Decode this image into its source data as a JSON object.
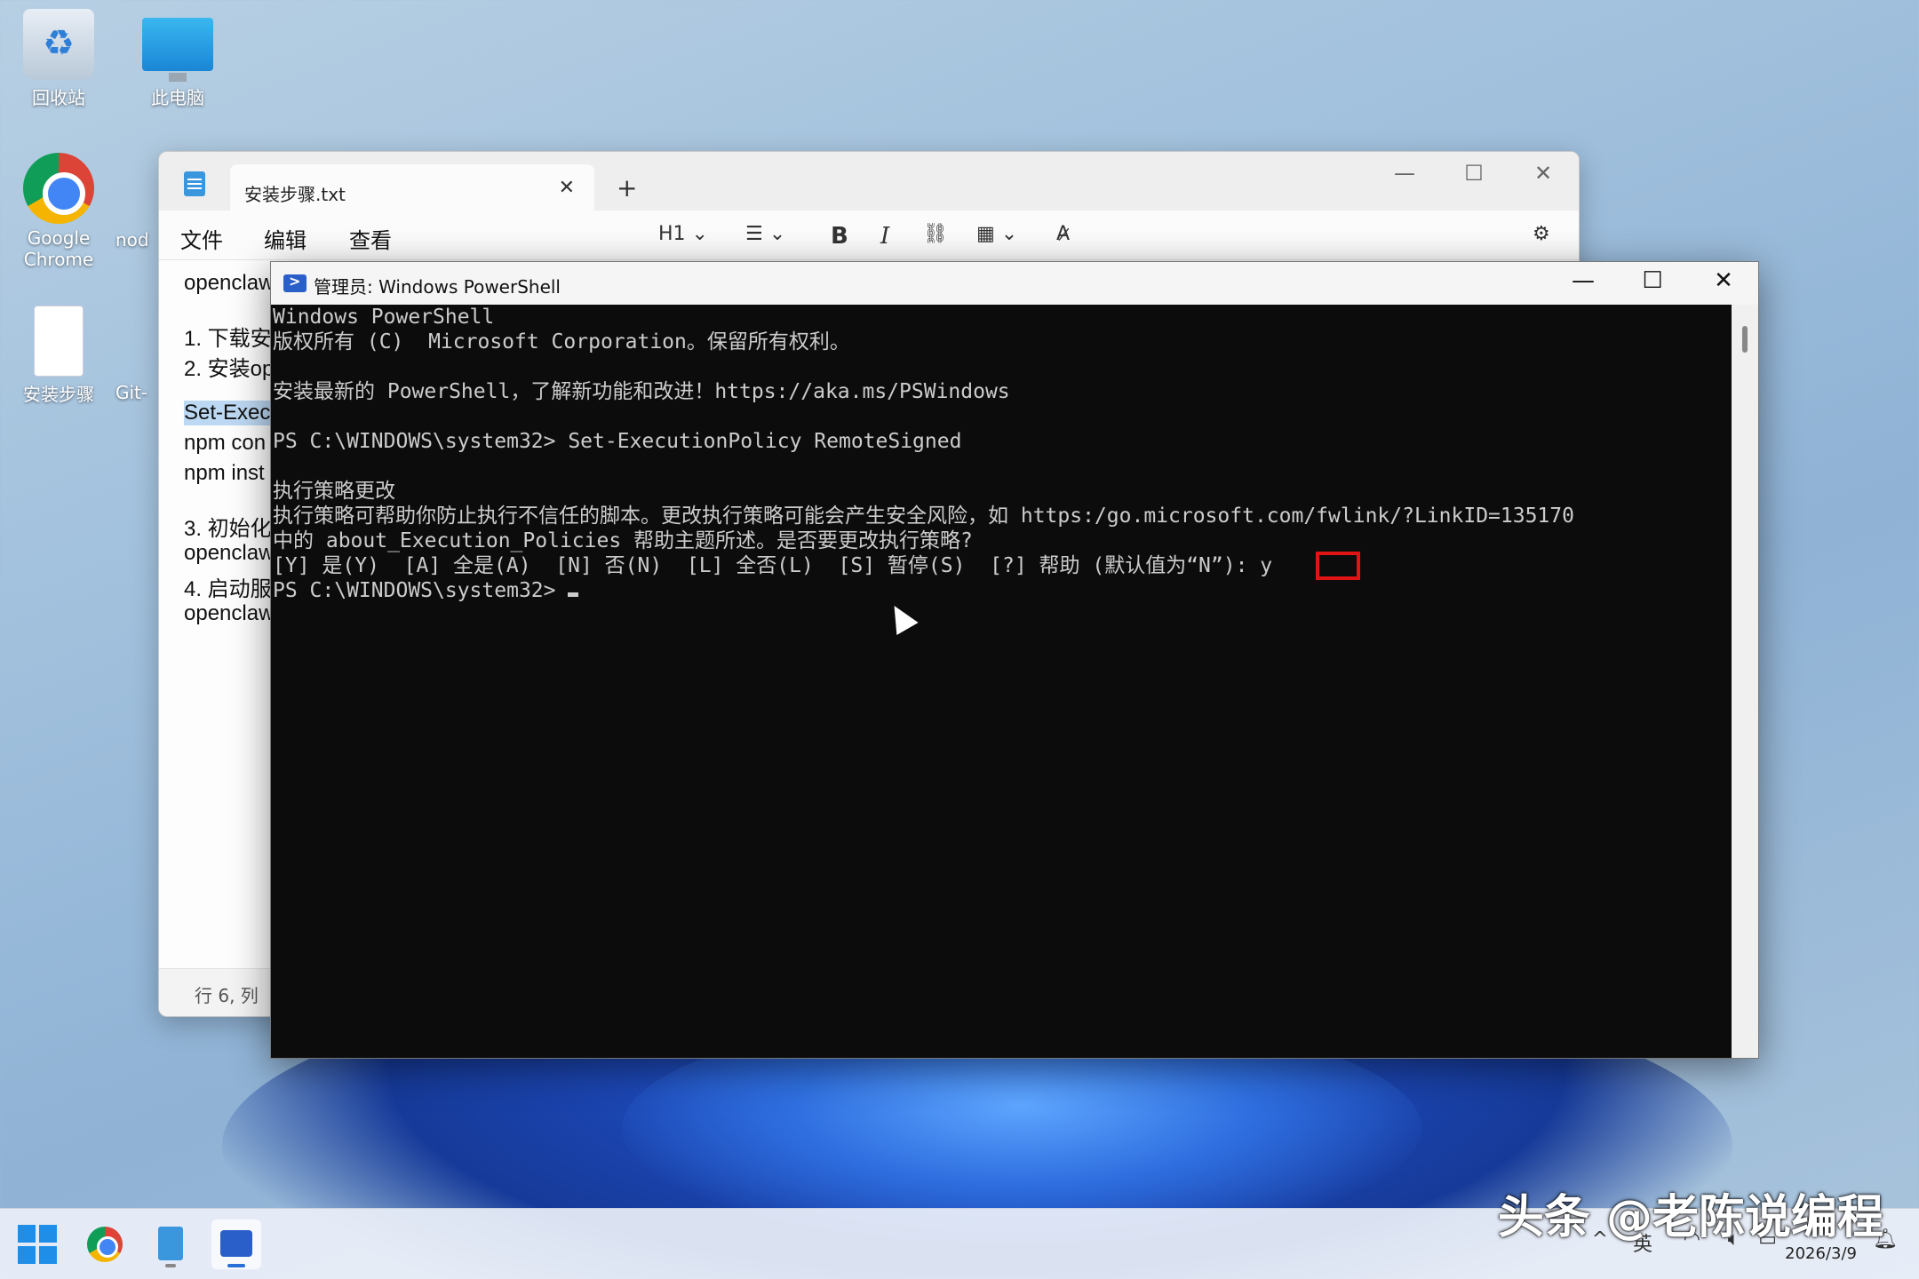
{
  "desktop": {
    "icons": [
      {
        "label": "回收站"
      },
      {
        "label": "此电脑"
      },
      {
        "label": "Google\nChrome"
      },
      {
        "label": "nod"
      },
      {
        "label": "安装步骤"
      },
      {
        "label": "Git-"
      }
    ]
  },
  "notepad": {
    "tab_title": "安装步骤.txt",
    "new_tab": "+",
    "menu": [
      "文件",
      "编辑",
      "查看"
    ],
    "toolbar": {
      "heading": "H1",
      "bold": "B",
      "italic": "I"
    },
    "lines": [
      "openclaw",
      "1. 下载安",
      "2. 安装op",
      "Set-Exec",
      "npm con",
      "npm inst",
      "3. 初始化",
      "openclaw",
      "4. 启动服",
      "openclaw"
    ],
    "status": "行 6, 列"
  },
  "powershell": {
    "title": "管理员: Windows PowerShell",
    "lines": [
      "Windows PowerShell",
      "版权所有 (C)  Microsoft Corporation。保留所有权利。",
      "",
      "安装最新的 PowerShell，了解新功能和改进！https://aka.ms/PSWindows",
      "",
      "PS C:\\WINDOWS\\system32> Set-ExecutionPolicy RemoteSigned",
      "",
      "执行策略更改",
      "执行策略可帮助你防止执行不信任的脚本。更改执行策略可能会产生安全风险，如 https:/go.microsoft.com/fwlink/?LinkID=135170",
      "中的 about_Execution_Policies 帮助主题所述。是否要更改执行策略?",
      "[Y] 是(Y)  [A] 全是(A)  [N] 否(N)  [L] 全否(L)  [S] 暂停(S)  [?] 帮助 (默认值为“N”): y",
      "PS C:\\WINDOWS\\system32> "
    ],
    "highlight_color": "#e01414"
  },
  "taskbar": {
    "date": "2026/3/9",
    "watermark": "头条 @老陈说编程"
  }
}
